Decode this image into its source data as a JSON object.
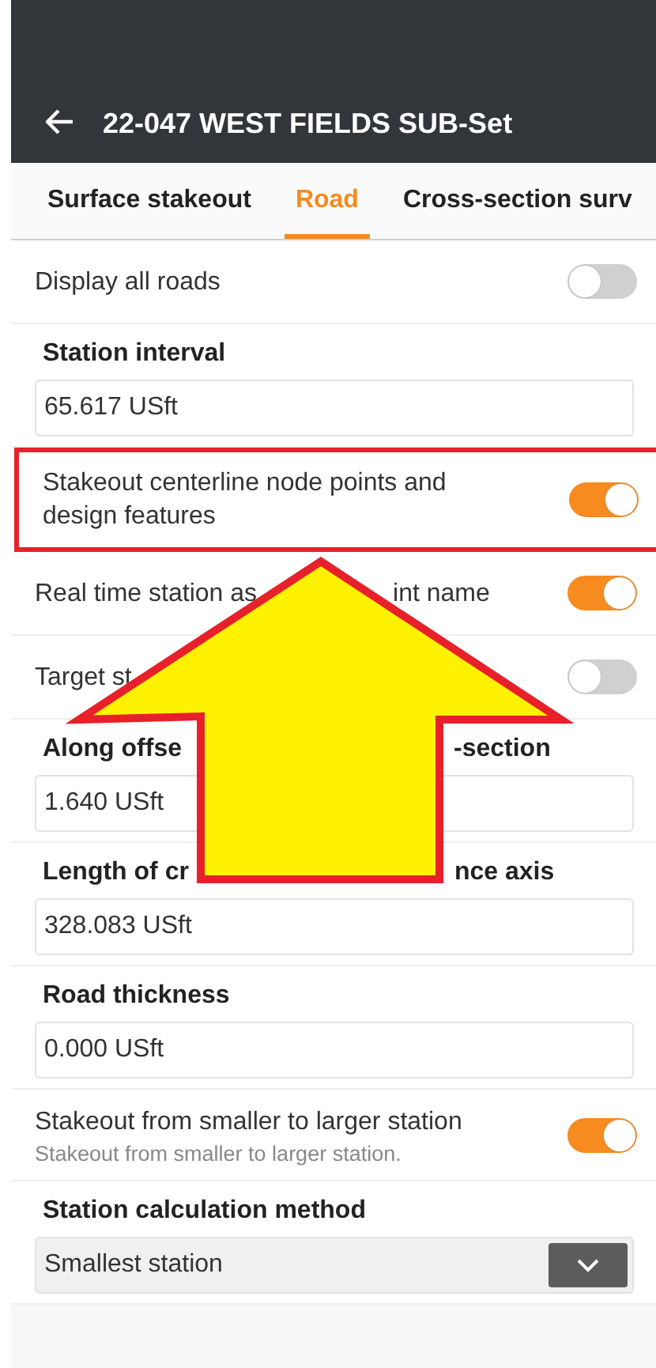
{
  "header": {
    "title": "22-047 WEST FIELDS SUB-Set"
  },
  "tabs": [
    {
      "label": "Surface stakeout",
      "selected": false
    },
    {
      "label": "Road",
      "selected": true
    },
    {
      "label": "Cross-section surv",
      "selected": false
    }
  ],
  "settings": [
    {
      "kind": "toggle",
      "label_parts": [
        "Display all roads"
      ],
      "on": false,
      "highlighted": false
    },
    {
      "kind": "field",
      "label_parts": [
        "Station interval"
      ],
      "value": "65.617 USft",
      "highlighted": false
    },
    {
      "kind": "toggle",
      "label_parts": [
        "Stakeout centerline node points and design features"
      ],
      "on": true,
      "highlighted": true
    },
    {
      "kind": "toggle",
      "label_parts": [
        "Real time station as",
        "int name"
      ],
      "on": true,
      "highlighted": false
    },
    {
      "kind": "toggle",
      "label_parts": [
        "Target st"
      ],
      "on": false,
      "highlighted": false
    },
    {
      "kind": "field",
      "label_parts": [
        "Along offse",
        "-section"
      ],
      "value": "1.640 USft",
      "highlighted": false
    },
    {
      "kind": "field",
      "label_parts": [
        "Length of cr",
        "nce axis"
      ],
      "value": "328.083 USft",
      "highlighted": false
    },
    {
      "kind": "field",
      "label_parts": [
        "Road thickness"
      ],
      "value": "0.000 USft",
      "highlighted": false
    },
    {
      "kind": "toggle",
      "label_parts": [
        "Stakeout from smaller to larger station"
      ],
      "description": "Stakeout from smaller to larger station.",
      "on": true,
      "highlighted": false
    },
    {
      "kind": "select",
      "label_parts": [
        "Station calculation method"
      ],
      "value": "Smallest station",
      "highlighted": false
    }
  ],
  "annotation": {
    "kind": "arrow"
  }
}
